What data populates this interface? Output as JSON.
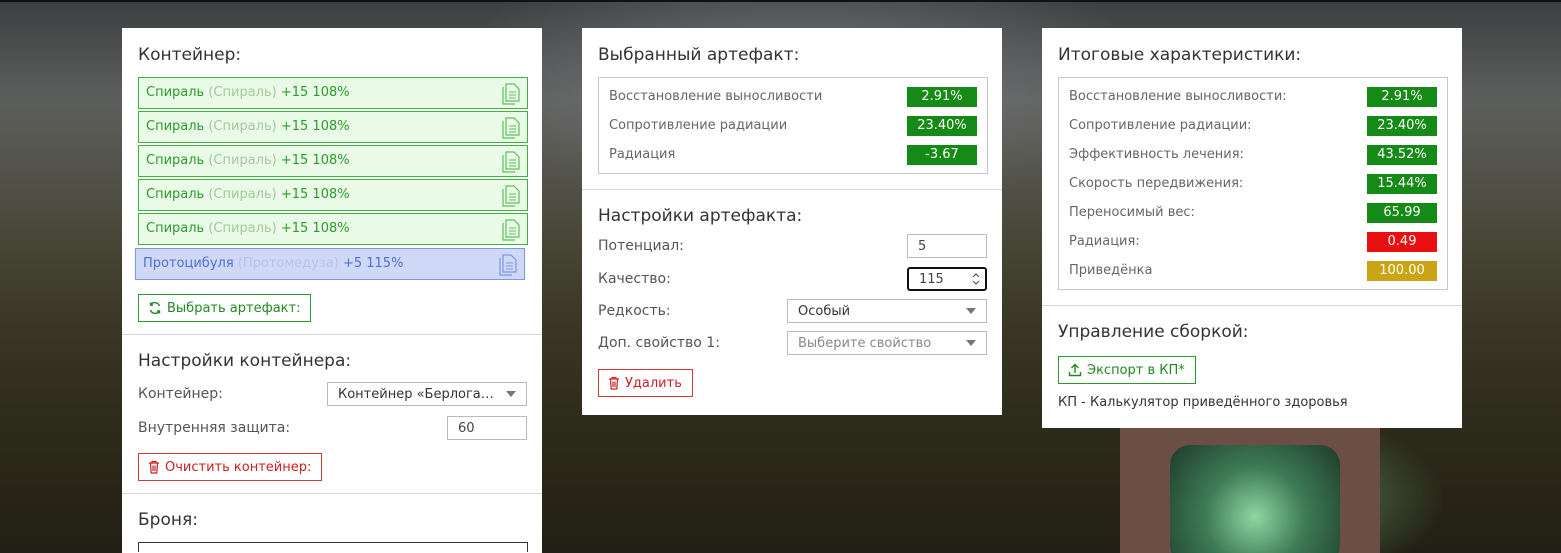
{
  "container_panel": {
    "title": "Контейнер:",
    "artifacts": [
      {
        "name": "Спираль",
        "original": "(Спираль)",
        "level": "+15 108%",
        "kind": "green"
      },
      {
        "name": "Спираль",
        "original": "(Спираль)",
        "level": "+15 108%",
        "kind": "green"
      },
      {
        "name": "Спираль",
        "original": "(Спираль)",
        "level": "+15 108%",
        "kind": "green"
      },
      {
        "name": "Спираль",
        "original": "(Спираль)",
        "level": "+15 108%",
        "kind": "green"
      },
      {
        "name": "Спираль",
        "original": "(Спираль)",
        "level": "+15 108%",
        "kind": "green"
      },
      {
        "name": "Протоцибуля",
        "original": "(Протомедуза)",
        "level": "+5 115%",
        "kind": "blue"
      }
    ],
    "choose_button": "Выбрать артефакт:",
    "settings_title": "Настройки контейнера:",
    "container_label": "Контейнер:",
    "container_value": "Контейнер «Берлога…",
    "protection_label": "Внутренняя защита:",
    "protection_value": "60",
    "clear_button": "Очистить контейнер:",
    "armor_title": "Броня:"
  },
  "selected_panel": {
    "title": "Выбранный артефакт:",
    "stats": [
      {
        "label": "Восстановление выносливости",
        "value": "2.91%",
        "color": "#168a16"
      },
      {
        "label": "Сопротивление радиации",
        "value": "23.40%",
        "color": "#168a16"
      },
      {
        "label": "Радиация",
        "value": "-3.67",
        "color": "#168a16"
      }
    ],
    "settings_title": "Настройки артефакта:",
    "potential_label": "Потенциал:",
    "potential_value": "5",
    "quality_label": "Качество:",
    "quality_value": "115",
    "rarity_label": "Редкость:",
    "rarity_value": "Особый",
    "extra_label": "Доп. свойство 1:",
    "extra_placeholder": "Выберите свойство",
    "delete_button": "Удалить"
  },
  "totals_panel": {
    "title": "Итоговые характеристики:",
    "stats": [
      {
        "label": "Восстановление выносливости:",
        "value": "2.91%",
        "color": "#168a16"
      },
      {
        "label": "Сопротивление радиации:",
        "value": "23.40%",
        "color": "#168a16"
      },
      {
        "label": "Эффективность лечения:",
        "value": "43.52%",
        "color": "#168a16"
      },
      {
        "label": "Скорость передвижения:",
        "value": "15.44%",
        "color": "#168a16"
      },
      {
        "label": "Переносимый вес:",
        "value": "65.99",
        "color": "#168a16"
      },
      {
        "label": "Радиация:",
        "value": "0.49",
        "color": "#e81010"
      },
      {
        "label": "Приведёнка",
        "value": "100.00",
        "color": "#c9a515"
      }
    ],
    "manage_title": "Управление сборкой:",
    "export_button": "Экспорт в КП*",
    "footnote": "КП - Калькулятор приведённого здоровья"
  }
}
